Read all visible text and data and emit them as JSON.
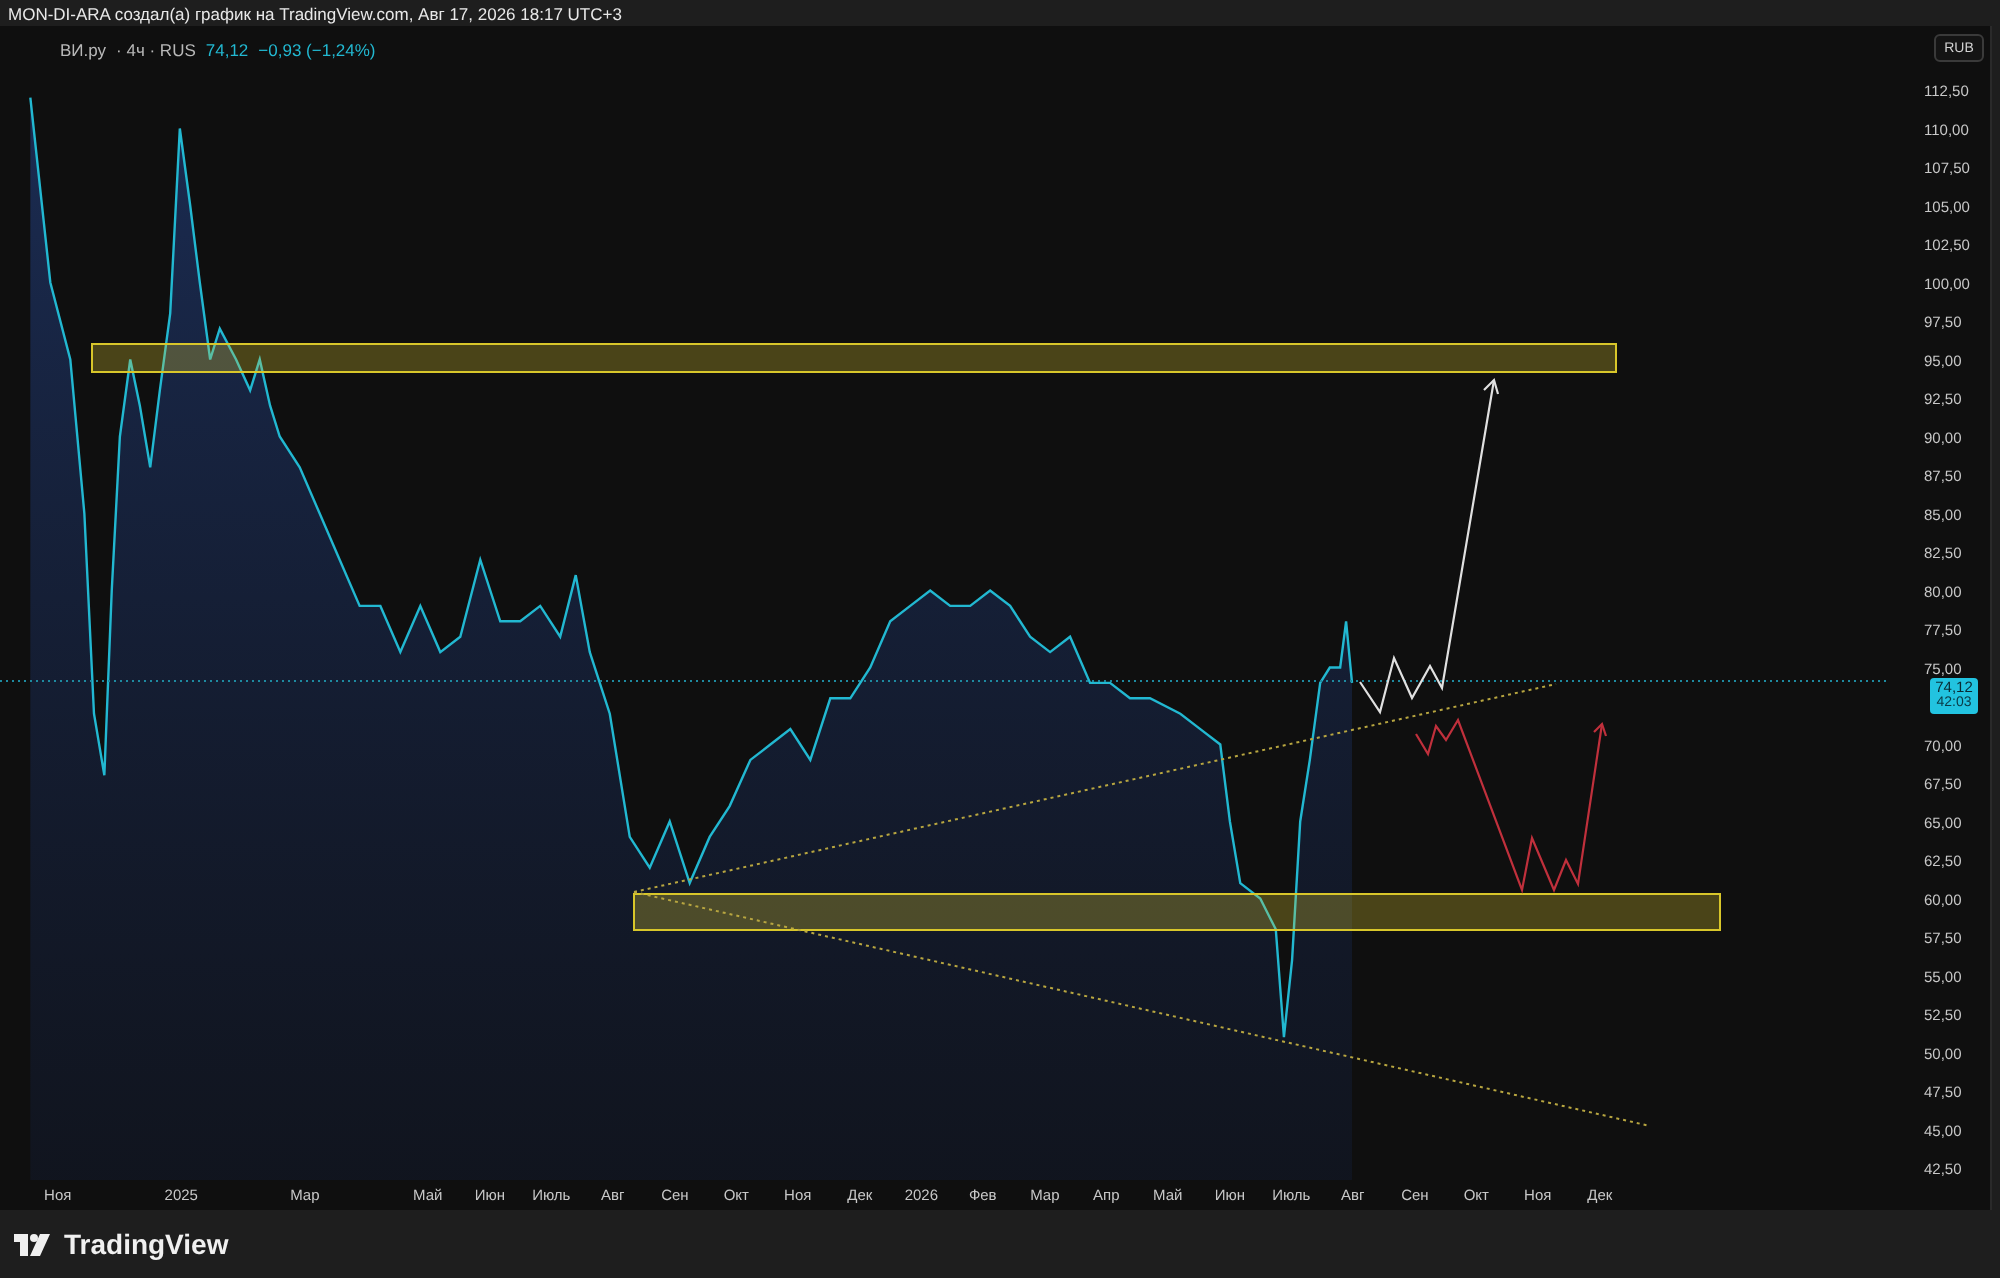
{
  "header": {
    "text": "MON-DI-ARA создал(а) график на TradingView.com, Авг 17, 2026 18:17 UTC+3"
  },
  "legend": {
    "details": "· 4ч · RUS",
    "price": "74,12",
    "change": "−0,93 (−1,24%)"
  },
  "currency_button": "RUB",
  "price_tag": {
    "price": "74,12",
    "countdown": "42:03"
  },
  "chart_data": {
    "type": "area",
    "ylim": [
      42.5,
      112.5
    ],
    "ref_lines": [
      {
        "axis": "y",
        "value": 74.12
      }
    ],
    "xlim": [
      2024.755,
      2027.309
    ],
    "x": [
      2024.796,
      2024.823,
      2024.85,
      2024.869,
      2024.882,
      2024.896,
      2024.906,
      2024.917,
      2024.931,
      2024.944,
      2024.958,
      2024.971,
      2024.985,
      2024.998,
      2025.012,
      2025.025,
      2025.039,
      2025.052,
      2025.074,
      2025.093,
      2025.106,
      2025.12,
      2025.133,
      2025.16,
      2025.187,
      2025.214,
      2025.241,
      2025.269,
      2025.296,
      2025.323,
      2025.35,
      2025.377,
      2025.404,
      2025.431,
      2025.458,
      2025.485,
      2025.512,
      2025.533,
      2025.552,
      2025.579,
      2025.606,
      2025.633,
      2025.66,
      2025.687,
      2025.714,
      2025.741,
      2025.769,
      2025.796,
      2025.823,
      2025.85,
      2025.877,
      2025.904,
      2025.931,
      2025.958,
      2025.985,
      2026.012,
      2026.039,
      2026.066,
      2026.093,
      2026.12,
      2026.147,
      2026.174,
      2026.201,
      2026.228,
      2026.255,
      2026.282,
      2026.309,
      2026.35,
      2026.377,
      2026.404,
      2026.417,
      2026.431,
      2026.458,
      2026.479,
      2026.49,
      2026.501,
      2026.512,
      2026.525,
      2026.539,
      2026.552,
      2026.566,
      2026.574,
      2026.582
    ],
    "series": [
      {
        "name": "ВИ.ру",
        "color": "#22b8d1",
        "values": [
          112,
          100,
          95,
          85,
          72,
          68,
          80,
          90,
          95,
          92,
          88,
          93,
          98,
          110,
          105,
          100,
          95,
          97,
          95,
          93,
          95,
          92,
          90,
          88,
          85,
          82,
          79,
          79,
          76,
          79,
          76,
          77,
          82,
          78,
          78,
          79,
          77,
          81,
          76,
          72,
          64,
          62,
          65,
          61,
          64,
          66,
          69,
          70,
          71,
          69,
          73,
          73,
          75,
          78,
          79,
          80,
          79,
          79,
          80,
          79,
          77,
          76,
          77,
          74,
          74,
          73,
          73,
          72,
          71,
          70,
          65,
          61,
          60,
          58,
          51,
          56,
          65,
          69,
          74,
          75,
          75,
          78,
          74
        ]
      }
    ],
    "xticks": [
      {
        "value": 2024.833,
        "label": "Ноя"
      },
      {
        "value": 2025,
        "label": "2025"
      },
      {
        "value": 2025.167,
        "label": "Мар"
      },
      {
        "value": 2025.333,
        "label": "Май"
      },
      {
        "value": 2025.417,
        "label": "Июн"
      },
      {
        "value": 2025.5,
        "label": "Июль"
      },
      {
        "value": 2025.583,
        "label": "Авг"
      },
      {
        "value": 2025.667,
        "label": "Сен"
      },
      {
        "value": 2025.75,
        "label": "Окт"
      },
      {
        "value": 2025.833,
        "label": "Ноя"
      },
      {
        "value": 2025.917,
        "label": "Дек"
      },
      {
        "value": 2026,
        "label": "2026"
      },
      {
        "value": 2026.083,
        "label": "Фев"
      },
      {
        "value": 2026.167,
        "label": "Мар"
      },
      {
        "value": 2026.25,
        "label": "Апр"
      },
      {
        "value": 2026.333,
        "label": "Май"
      },
      {
        "value": 2026.417,
        "label": "Июн"
      },
      {
        "value": 2026.5,
        "label": "Июль"
      },
      {
        "value": 2026.583,
        "label": "Авг"
      },
      {
        "value": 2026.667,
        "label": "Сен"
      },
      {
        "value": 2026.75,
        "label": "Окт"
      },
      {
        "value": 2026.833,
        "label": "Ноя"
      },
      {
        "value": 2026.917,
        "label": "Дек"
      }
    ],
    "yticks": [
      {
        "value": 112.5,
        "label": "112,50"
      },
      {
        "value": 110,
        "label": "110,00"
      },
      {
        "value": 107.5,
        "label": "107,50"
      },
      {
        "value": 105,
        "label": "105,00"
      },
      {
        "value": 102.5,
        "label": "102,50"
      },
      {
        "value": 100,
        "label": "100,00"
      },
      {
        "value": 97.5,
        "label": "97,50"
      },
      {
        "value": 95,
        "label": "95,00"
      },
      {
        "value": 92.5,
        "label": "92,50"
      },
      {
        "value": 90,
        "label": "90,00"
      },
      {
        "value": 87.5,
        "label": "87,50"
      },
      {
        "value": 85,
        "label": "85,00"
      },
      {
        "value": 82.5,
        "label": "82,50"
      },
      {
        "value": 80,
        "label": "80,00"
      },
      {
        "value": 77.5,
        "label": "77,50"
      },
      {
        "value": 75,
        "label": "75,00"
      },
      {
        "value": 70,
        "label": "70,00"
      },
      {
        "value": 67.5,
        "label": "67,50"
      },
      {
        "value": 65,
        "label": "65,00"
      },
      {
        "value": 62.5,
        "label": "62,50"
      },
      {
        "value": 60,
        "label": "60,00"
      },
      {
        "value": 57.5,
        "label": "57,50"
      },
      {
        "value": 55,
        "label": "55,00"
      },
      {
        "value": 52.5,
        "label": "52,50"
      },
      {
        "value": 50,
        "label": "50,00"
      },
      {
        "value": 47.5,
        "label": "47,50"
      },
      {
        "value": 45,
        "label": "45,00"
      },
      {
        "value": 42.5,
        "label": "42,50"
      }
    ]
  },
  "footer": {
    "logo_text": "TradingView"
  }
}
